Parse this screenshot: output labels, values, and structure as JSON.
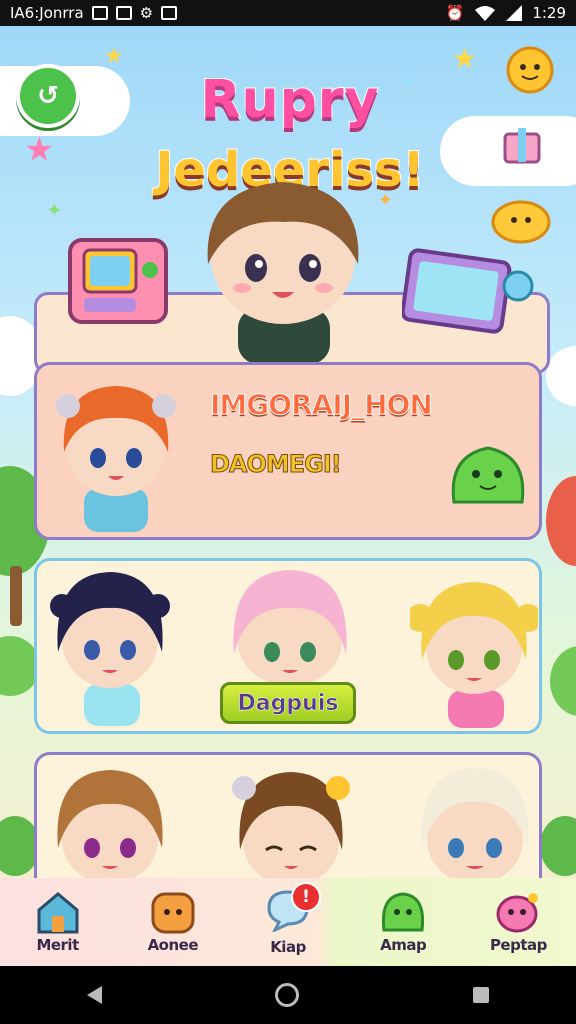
{
  "status_bar": {
    "carrier_text": "IA6:Jonrra",
    "time": "1:29",
    "icons": [
      "image-icon",
      "download-icon",
      "settings-icon",
      "save-icon",
      "alarm-icon",
      "wifi-icon",
      "signal-icon"
    ]
  },
  "header": {
    "title_line1": "Rupry",
    "title_line2": "Jedeeriss!",
    "back_icon": "back-icon"
  },
  "featured_card": {
    "title": "IMGORAIJ_HON",
    "subtitle": "DAOMEGI!"
  },
  "character_row": {
    "button_label": "Dagpuis"
  },
  "bottom_nav": {
    "items": [
      {
        "label": "Merit",
        "icon": "house-icon"
      },
      {
        "label": "Aonee",
        "icon": "toast-icon"
      },
      {
        "label": "Kiap",
        "icon": "chat-bubble-icon",
        "badge": "!"
      },
      {
        "label": "Amap",
        "icon": "slime-icon"
      },
      {
        "label": "Peptap",
        "icon": "pink-creature-icon"
      }
    ]
  },
  "colors": {
    "title_pink": "#ff4fa2",
    "title_yellow": "#ffc531",
    "card_border": "#8e7cc9",
    "button_green": "#9fce24",
    "badge_red": "#e83030"
  }
}
